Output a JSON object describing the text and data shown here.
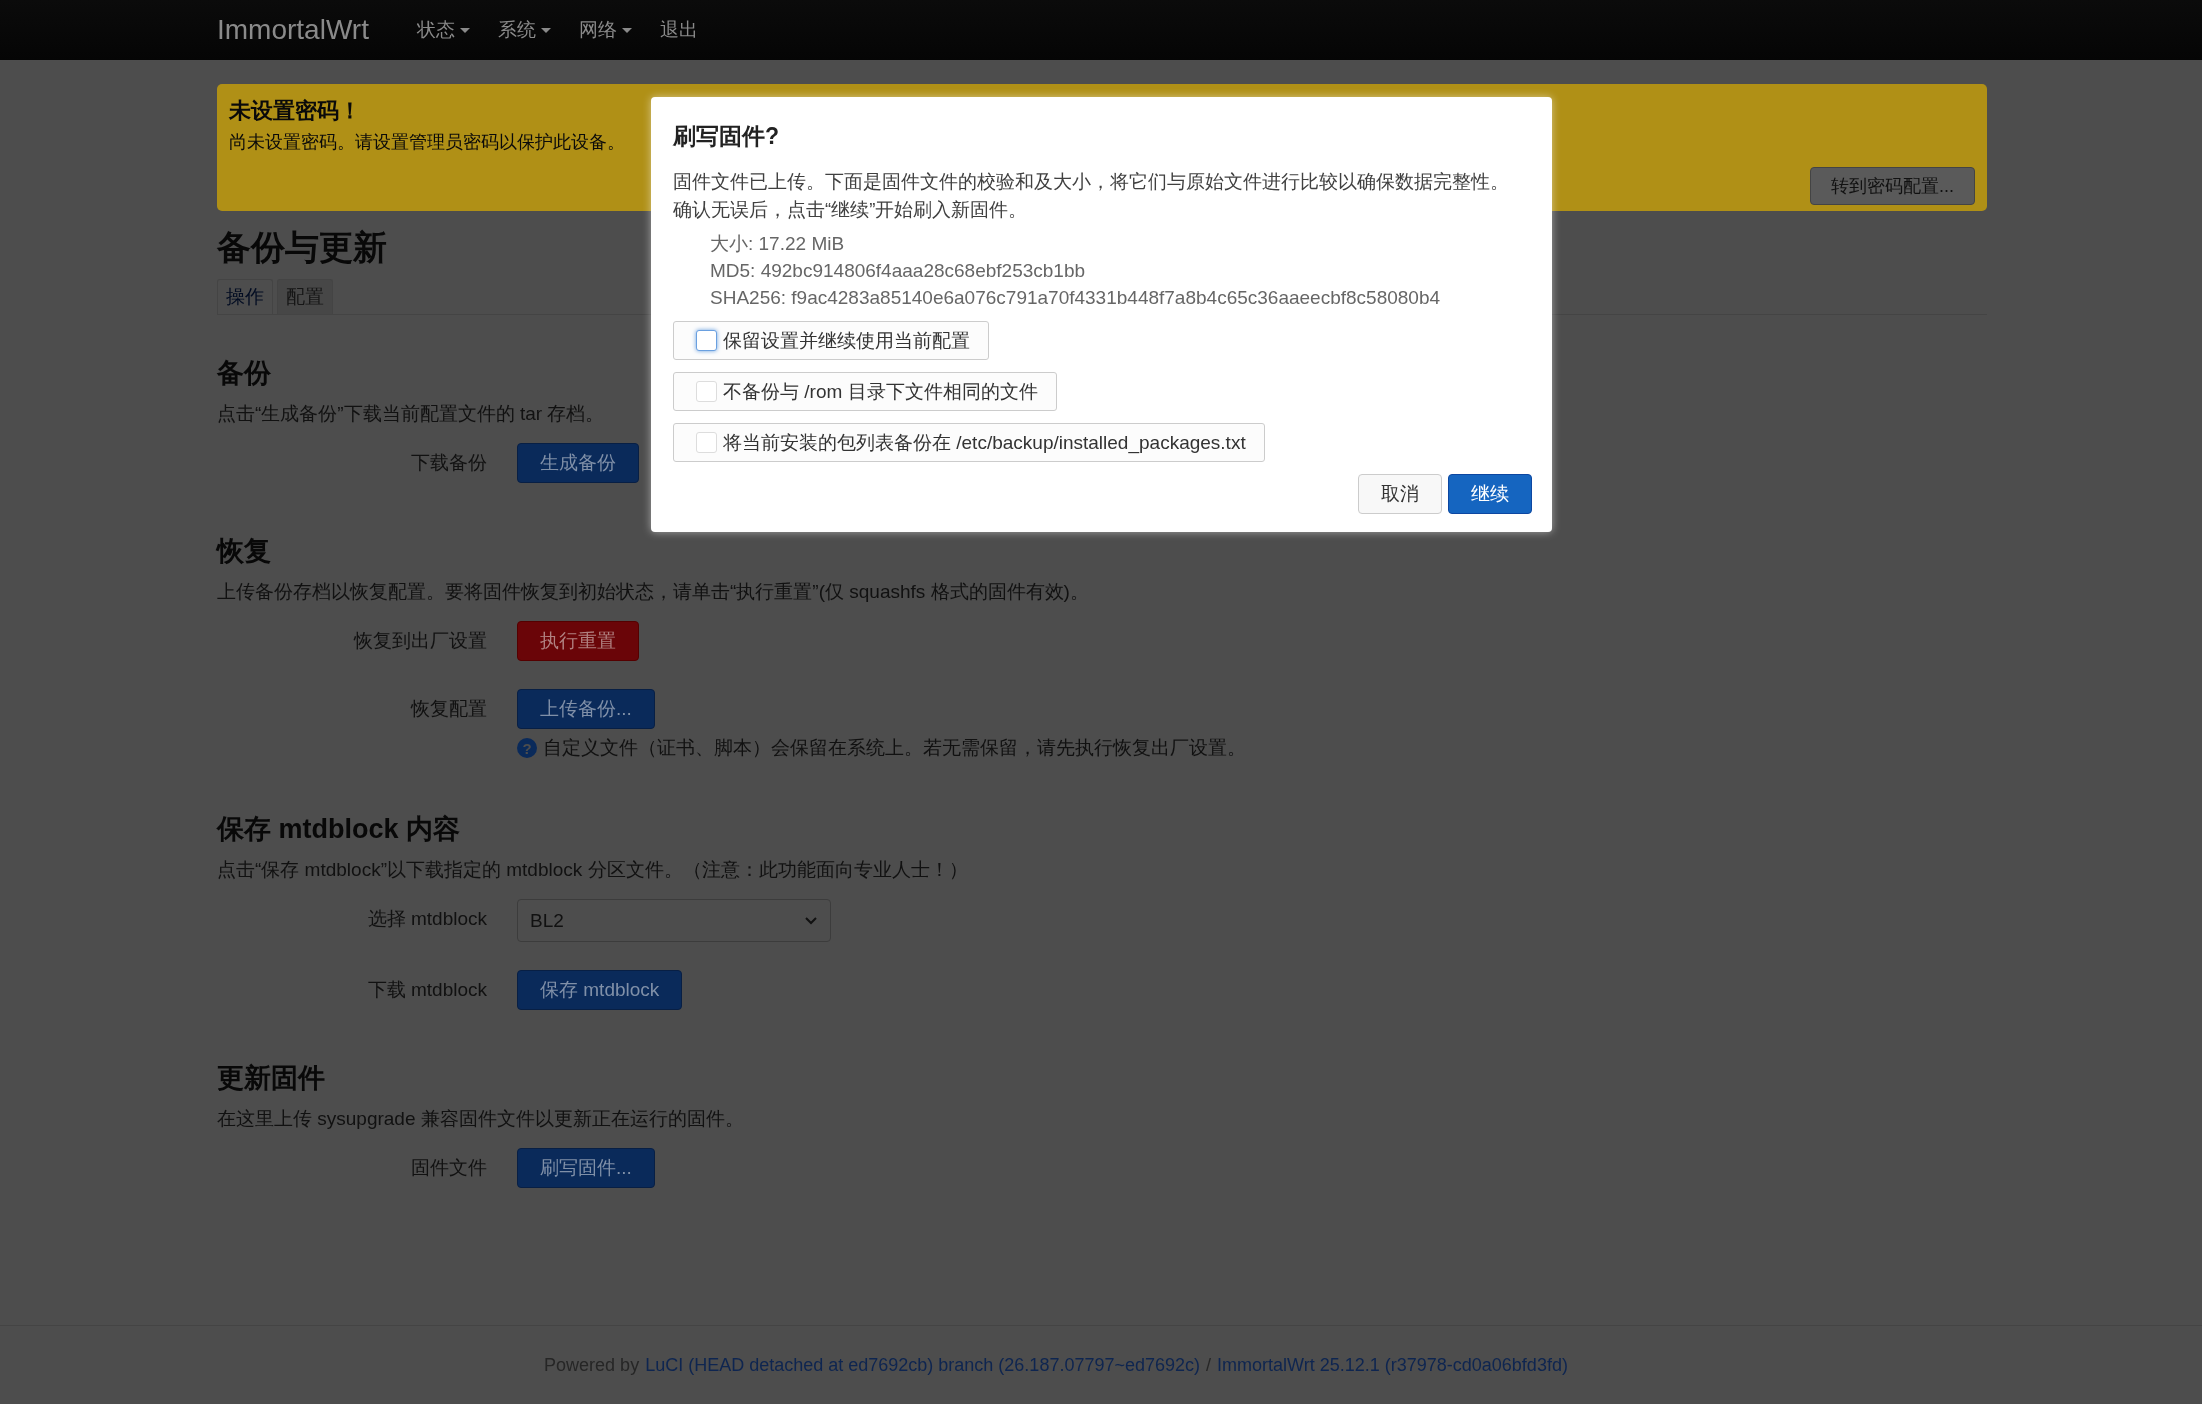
{
  "navbar": {
    "brand": "ImmortalWrt",
    "menu": [
      {
        "label": "状态",
        "dropdown": true
      },
      {
        "label": "系统",
        "dropdown": true
      },
      {
        "label": "网络",
        "dropdown": true
      },
      {
        "label": "退出",
        "dropdown": false
      }
    ]
  },
  "alert": {
    "title": "未设置密码！",
    "text": "尚未设置密码。请设置管理员密码以保护此设备。",
    "button": "转到密码配置..."
  },
  "page_title": "备份与更新",
  "tabs": [
    {
      "label": "操作",
      "selected": true
    },
    {
      "label": "配置",
      "selected": false
    }
  ],
  "sections": [
    {
      "title": "备份",
      "description": "点击“生成备份”下载当前配置文件的 tar 存档。",
      "rows": [
        {
          "label": "下载备份",
          "kind": "primary",
          "value": "生成备份"
        }
      ]
    },
    {
      "title": "恢复",
      "description": "上传备份存档以恢复配置。要将固件恢复到初始状态，请单击“执行重置”(仅 squashfs 格式的固件有效)。",
      "rows": [
        {
          "label": "恢复到出厂设置",
          "kind": "danger",
          "value": "执行重置"
        },
        {
          "label": "恢复配置",
          "kind": "primary",
          "value": "上传备份...",
          "help_icon": "?",
          "help": "自定义文件（证书、脚本）会保留在系统上。若无需保留，请先执行恢复出厂设置。"
        }
      ]
    },
    {
      "title": "保存 mtdblock 内容",
      "description": "点击“保存 mtdblock”以下载指定的 mtdblock 分区文件。（注意：此功能面向专业人士！）",
      "rows": [
        {
          "label": "选择 mtdblock",
          "kind": "select",
          "value": "BL2"
        },
        {
          "label": "下载 mtdblock",
          "kind": "primary",
          "value": "保存 mtdblock"
        }
      ]
    },
    {
      "title": "更新固件",
      "description": "在这里上传 sysupgrade 兼容固件文件以更新正在运行的固件。",
      "rows": [
        {
          "label": "固件文件",
          "kind": "primary",
          "value": "刷写固件..."
        }
      ]
    }
  ],
  "footer": {
    "prefix": "Powered by",
    "luci_link": "LuCI (HEAD detached at ed7692cb) branch (26.187.07797~ed7692c)",
    "separator": "/",
    "distro_link": "ImmortalWrt 25.12.1 (r37978-cd0a06bfd3fd)"
  },
  "dialog": {
    "title": "刷写固件?",
    "text": [
      "固件文件已上传。下面是固件文件的校验和及大小，将它们与原始文件进行比较以确保数据完整性。",
      "确认无误后，点击“继续”开始刷入新固件。"
    ],
    "details": [
      "大小: 17.22 MiB",
      "MD5: 492bc914806f4aaa28c68ebf253cb1bb",
      "SHA256: f9ac4283a85140e6a076c791a70f4331b448f7a8b4c65c36aaeecbf8c58080b4"
    ],
    "options": [
      {
        "label": "保留设置并继续使用当前配置",
        "checked": false
      },
      {
        "label": "不备份与 /rom 目录下文件相同的文件",
        "checked": false
      },
      {
        "label": "将当前安装的包列表备份在 /etc/backup/installed_packages.txt",
        "checked": false
      }
    ],
    "buttons": [
      {
        "label": "取消",
        "kind": "default"
      },
      {
        "label": "继续",
        "kind": "primary"
      }
    ]
  }
}
